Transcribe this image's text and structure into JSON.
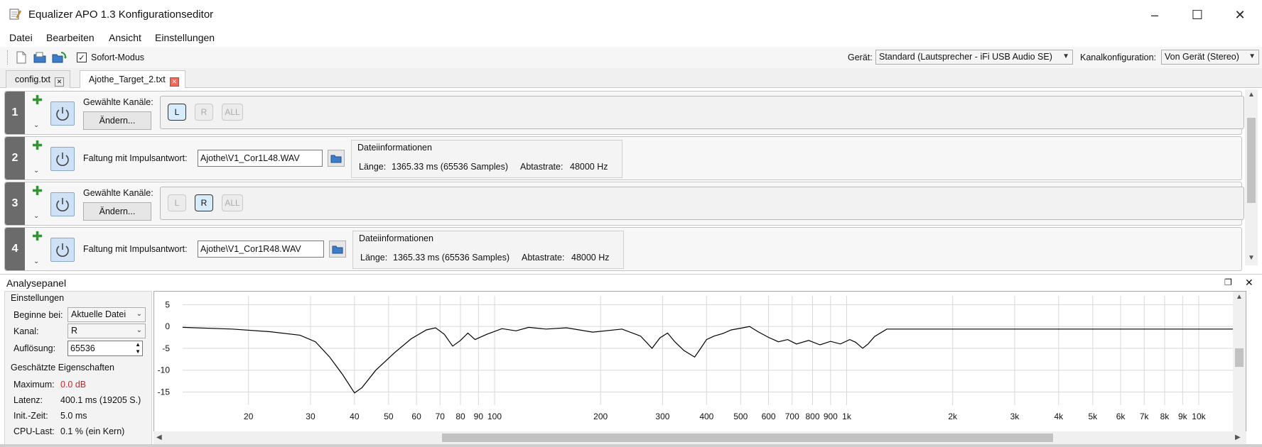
{
  "window": {
    "title": "Equalizer APO 1.3 Konfigurationseditor",
    "controls": [
      "–",
      "☐",
      "✕"
    ]
  },
  "menu": [
    "Datei",
    "Bearbeiten",
    "Ansicht",
    "Einstellungen"
  ],
  "toolbar": {
    "instant_mode_label": "Sofort-Modus",
    "instant_mode_checked": true,
    "device_label": "Gerät:",
    "device_value": "Standard (Lautsprecher - iFi USB Audio SE)",
    "channel_config_label": "Kanalkonfiguration:",
    "channel_config_value": "Von Gerät (Stereo)"
  },
  "tabs": [
    {
      "label": "config.txt",
      "active": false
    },
    {
      "label": "Ajothe_Target_2.txt",
      "active": true
    }
  ],
  "rows": [
    {
      "number": "1",
      "type": "channels",
      "label": "Gewählte Kanäle:",
      "change_button": "Ändern...",
      "channels": [
        {
          "label": "L",
          "selected": true
        },
        {
          "label": "R",
          "selected": false
        },
        {
          "label": "ALL",
          "selected": false
        }
      ]
    },
    {
      "number": "2",
      "type": "convolution",
      "label": "Faltung mit Impulsantwort:",
      "file": "Ajothe\\V1_Cor1L48.WAV",
      "info_title": "Dateiinformationen",
      "length_label": "Länge:",
      "length_value": "1365.33 ms (65536 Samples)",
      "rate_label": "Abtastrate:",
      "rate_value": "48000 Hz"
    },
    {
      "number": "3",
      "type": "channels",
      "label": "Gewählte Kanäle:",
      "change_button": "Ändern...",
      "channels": [
        {
          "label": "L",
          "selected": false
        },
        {
          "label": "R",
          "selected": true
        },
        {
          "label": "ALL",
          "selected": false
        }
      ]
    },
    {
      "number": "4",
      "type": "convolution",
      "label": "Faltung mit Impulsantwort:",
      "file": "Ajothe\\V1_Cor1R48.WAV",
      "info_title": "Dateiinformationen",
      "length_label": "Länge:",
      "length_value": "1365.33 ms (65536 Samples)",
      "rate_label": "Abtastrate:",
      "rate_value": "48000 Hz"
    }
  ],
  "analysis": {
    "title": "Analysepanel",
    "settings_title": "Einstellungen",
    "start_label": "Beginne bei:",
    "start_value": "Aktuelle Datei",
    "channel_label": "Kanal:",
    "channel_value": "R",
    "resolution_label": "Auflösung:",
    "resolution_value": "65536",
    "props_title": "Geschätzte Eigenschaften",
    "max_label": "Maximum:",
    "max_value": "0.0 dB",
    "latency_label": "Latenz:",
    "latency_value": "400.1 ms (19205 S.)",
    "init_label": "Init.-Zeit:",
    "init_value": "5.0 ms",
    "cpu_label": "CPU-Last:",
    "cpu_value": "0.1 % (ein Kern)"
  },
  "chart_data": {
    "type": "line",
    "x_scale": "log",
    "xlim": [
      13,
      12500
    ],
    "ylim": [
      -18,
      7
    ],
    "y_ticks": [
      5,
      0,
      -5,
      -10,
      -15
    ],
    "x_ticks": [
      {
        "v": 20,
        "label": "20"
      },
      {
        "v": 30,
        "label": "30"
      },
      {
        "v": 40,
        "label": "40"
      },
      {
        "v": 50,
        "label": "50"
      },
      {
        "v": 60,
        "label": "60"
      },
      {
        "v": 70,
        "label": "70"
      },
      {
        "v": 80,
        "label": "80"
      },
      {
        "v": 90,
        "label": "90"
      },
      {
        "v": 100,
        "label": "100"
      },
      {
        "v": 200,
        "label": "200"
      },
      {
        "v": 300,
        "label": "300"
      },
      {
        "v": 400,
        "label": "400"
      },
      {
        "v": 500,
        "label": "500"
      },
      {
        "v": 600,
        "label": "600"
      },
      {
        "v": 700,
        "label": "700"
      },
      {
        "v": 800,
        "label": "800"
      },
      {
        "v": 900,
        "label": "900"
      },
      {
        "v": 1000,
        "label": "1k"
      },
      {
        "v": 2000,
        "label": "2k"
      },
      {
        "v": 3000,
        "label": "3k"
      },
      {
        "v": 4000,
        "label": "4k"
      },
      {
        "v": 5000,
        "label": "5k"
      },
      {
        "v": 6000,
        "label": "6k"
      },
      {
        "v": 7000,
        "label": "7k"
      },
      {
        "v": 8000,
        "label": "8k"
      },
      {
        "v": 9000,
        "label": "9k"
      },
      {
        "v": 10000,
        "label": "10k"
      }
    ],
    "grid": true,
    "series": [
      {
        "color": "#000000",
        "x": [
          13,
          18,
          23,
          28,
          31,
          34,
          37,
          40,
          42,
          46,
          52,
          58,
          64,
          68,
          72,
          76,
          80,
          84,
          88,
          95,
          105,
          115,
          125,
          140,
          160,
          190,
          230,
          260,
          280,
          295,
          310,
          325,
          345,
          370,
          385,
          400,
          420,
          445,
          470,
          500,
          530,
          560,
          600,
          640,
          680,
          720,
          780,
          840,
          900,
          960,
          1020,
          1060,
          1110,
          1150,
          1200,
          1300,
          2000,
          5000,
          12500
        ],
        "y": [
          -0.2,
          -0.6,
          -1.2,
          -2.0,
          -3.5,
          -7.0,
          -11.0,
          -15.2,
          -14.0,
          -10.0,
          -6.0,
          -2.8,
          -0.8,
          -0.3,
          -1.8,
          -4.5,
          -3.2,
          -1.5,
          -3.0,
          -1.8,
          -0.5,
          -1.0,
          -0.2,
          -0.6,
          -0.3,
          -1.3,
          -0.6,
          -2.2,
          -5.0,
          -2.6,
          -1.5,
          -3.5,
          -5.5,
          -7.0,
          -5.0,
          -3.0,
          -2.2,
          -1.6,
          -0.8,
          -0.4,
          0.0,
          -1.2,
          -2.5,
          -3.5,
          -3.0,
          -4.0,
          -3.2,
          -4.2,
          -3.4,
          -4.0,
          -3.0,
          -3.6,
          -5.0,
          -4.0,
          -2.3,
          -0.6,
          -0.6,
          -0.6,
          -0.6
        ]
      }
    ]
  }
}
